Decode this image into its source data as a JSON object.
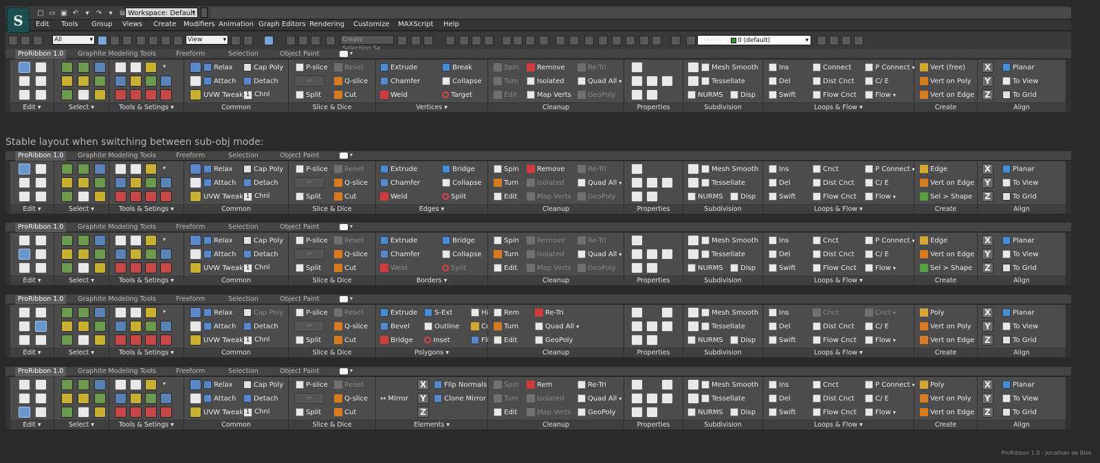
{
  "window": {
    "logo": "S",
    "workspace": "Workspace: Default",
    "quick_access_glyphs": [
      "□",
      "▭",
      "▣",
      "↶",
      "▾",
      "↷",
      "▾",
      "⧉"
    ]
  },
  "menu": [
    "Edit",
    "Tools",
    "Group",
    "Views",
    "Create",
    "Modifiers",
    "Animation",
    "Graph Editors",
    "Rendering",
    "Customize",
    "MAXScript",
    "Help"
  ],
  "toolbar": {
    "filter": "All",
    "view": "View",
    "named_selection_placeholder": "Create Selection Se",
    "layer": "0 (default)"
  },
  "tabs": {
    "active": "ProRibbon 1.0",
    "others": [
      "Graphite Modeling Tools",
      "Freeform",
      "Selection",
      "Object Paint"
    ]
  },
  "caption": "Stable layout when switching between sub-obj mode:",
  "credit": "ProRibbon 1.0  -  Jonathan de Blok",
  "panels_common": {
    "edit": "Edit",
    "select": "Select",
    "tools": "Tools & Setings",
    "common": "Common",
    "slice": "Slice & Dice",
    "cleanup": "Cleanup",
    "properties": "Properties",
    "subdivision": "Subdivision",
    "loops": "Loops & Flow",
    "create": "Create",
    "align": "Align"
  },
  "common_items": {
    "relax": "Relax",
    "attach": "Attach",
    "uvw": "UVW Tweak",
    "chnl_value": "1",
    "chnl": "Chnl",
    "cap_poly": "Cap Poly",
    "detach": "Detach"
  },
  "slice_items": {
    "pslice": "P-slice",
    "reset": "Reset",
    "qslice": "Q-slice",
    "split": "Split",
    "cut": "Cut"
  },
  "subdivision_items": {
    "mesh_smooth": "Mesh Smooth",
    "tessellate": "Tessellate",
    "nurms": "NURMS",
    "disp": "Disp"
  },
  "align_items": {
    "planar": "Planar",
    "to_view": "To View",
    "to_grid": "To Grid",
    "x": "X",
    "y": "Y",
    "z": "Z"
  },
  "ribbons": [
    {
      "mode": "Vertices",
      "sub": {
        "title": "Vertices",
        "items": [
          [
            "Extrude",
            "Chamfer",
            "Weld"
          ],
          [
            "Break",
            "Collapse",
            "Target"
          ]
        ]
      },
      "cleanup": [
        [
          "Spin",
          "Turn",
          "Edit"
        ],
        [
          "Remove",
          "Isolated",
          "Map Verts"
        ],
        [
          "Re-Tri",
          "Quad All",
          "GeoPoly"
        ]
      ],
      "cleanup_on": [
        [
          false,
          false,
          false
        ],
        [
          true,
          true,
          true
        ],
        [
          false,
          true,
          false
        ]
      ],
      "loops": [
        [
          "Ins",
          "Del",
          "Swift"
        ],
        [
          "Connect",
          "Dist Cnct",
          "Flow Cnct"
        ],
        [
          "P Connect",
          "C/ E",
          "Flow"
        ]
      ],
      "create": [
        "Vert (free)",
        "Vert on Poly",
        "Vert on Edge"
      ]
    },
    {
      "mode": "Edges",
      "sub": {
        "title": "Edges",
        "items": [
          [
            "Extrude",
            "Chamfer",
            "Weld"
          ],
          [
            "Bridge",
            "Collapse",
            "Split"
          ]
        ]
      },
      "cleanup": [
        [
          "Spin",
          "Turn",
          "Edit"
        ],
        [
          "Remove",
          "Isolated",
          "Map Verts"
        ],
        [
          "Re-Tri",
          "Quad All",
          "GeoPoly"
        ]
      ],
      "cleanup_on": [
        [
          true,
          true,
          true
        ],
        [
          true,
          false,
          false
        ],
        [
          false,
          true,
          false
        ]
      ],
      "loops": [
        [
          "Ins",
          "Del",
          "Swift"
        ],
        [
          "Cnct",
          "Dist Cnct",
          "Flow Cnct"
        ],
        [
          "P Connect",
          "C/ E",
          "Flow"
        ]
      ],
      "create": [
        "Edge",
        "Vert on Edge",
        "Sel > Shape"
      ]
    },
    {
      "mode": "Borders",
      "sub": {
        "title": "Borders",
        "items": [
          [
            "Extrude",
            "Chamfer",
            "Weld"
          ],
          [
            "Bridge",
            "Collapse",
            "Split"
          ]
        ]
      },
      "cleanup": [
        [
          "Spin",
          "Turn",
          "Edit"
        ],
        [
          "Remove",
          "Isolated",
          "Map Verts"
        ],
        [
          "Re-Tri",
          "Quad All",
          "GeoPoly"
        ]
      ],
      "cleanup_on": [
        [
          true,
          true,
          true
        ],
        [
          false,
          false,
          false
        ],
        [
          false,
          true,
          false
        ]
      ],
      "loops": [
        [
          "Ins",
          "Del",
          "Swift"
        ],
        [
          "Cnct",
          "Dist Cnct",
          "Flow Cnct"
        ],
        [
          "P Connect",
          "C/ E",
          "Flow"
        ]
      ],
      "create": [
        "Edge",
        "Vert on Edge",
        "Sel > Shape"
      ]
    },
    {
      "mode": "Polygons",
      "sub": {
        "title": "Polygons",
        "items": [
          [
            "Extrude",
            "Bevel",
            "Bridge"
          ],
          [
            "S-Ext",
            "Outline",
            "Inset"
          ],
          [
            "Hinge",
            "Collapse",
            "Flip"
          ]
        ]
      },
      "cleanup": [
        [
          "Rem",
          "Turn",
          "Edit"
        ],
        [
          "Re-Tri",
          "Quad All",
          "GeoPoly"
        ]
      ],
      "cleanup_on": [
        [
          true,
          true,
          true
        ],
        [
          true,
          true,
          true
        ]
      ],
      "loops": [
        [
          "Ins",
          "Del",
          "Swift"
        ],
        [
          "Cnct",
          "Dist Cnct",
          "Flow Cnct"
        ],
        [
          "Cnct",
          "C/ E",
          "Flow"
        ]
      ],
      "create": [
        "Poly",
        "Vert on Poly",
        "Vert on Edge"
      ]
    },
    {
      "mode": "Elements",
      "sub": {
        "title": "Elements",
        "mirror": "Mirror",
        "x": "X",
        "y": "Y",
        "z": "Z",
        "items": [
          [
            "Flip Normals",
            "Clone Mirror"
          ]
        ]
      },
      "cleanup": [
        [
          "Spin",
          "Turn",
          "Edit"
        ],
        [
          "Rem",
          "Isolated",
          "Map Verts"
        ],
        [
          "Re-Tri",
          "Quad All",
          "GeoPoly"
        ]
      ],
      "cleanup_on": [
        [
          false,
          false,
          true
        ],
        [
          true,
          false,
          false
        ],
        [
          true,
          true,
          true
        ]
      ],
      "loops": [
        [
          "Ins",
          "Del",
          "Swift"
        ],
        [
          "Cnct",
          "Dist Cnct",
          "Flow Cnct"
        ],
        [
          "P Connect",
          "C/ E",
          "Flow"
        ]
      ],
      "create": [
        "Poly",
        "Vert on Poly",
        "Vert on Edge"
      ]
    }
  ],
  "colors": {
    "accent_blue": "#5a88c8",
    "panel_bg": "#4c4c4c",
    "app_bg": "#2a2a2a"
  }
}
